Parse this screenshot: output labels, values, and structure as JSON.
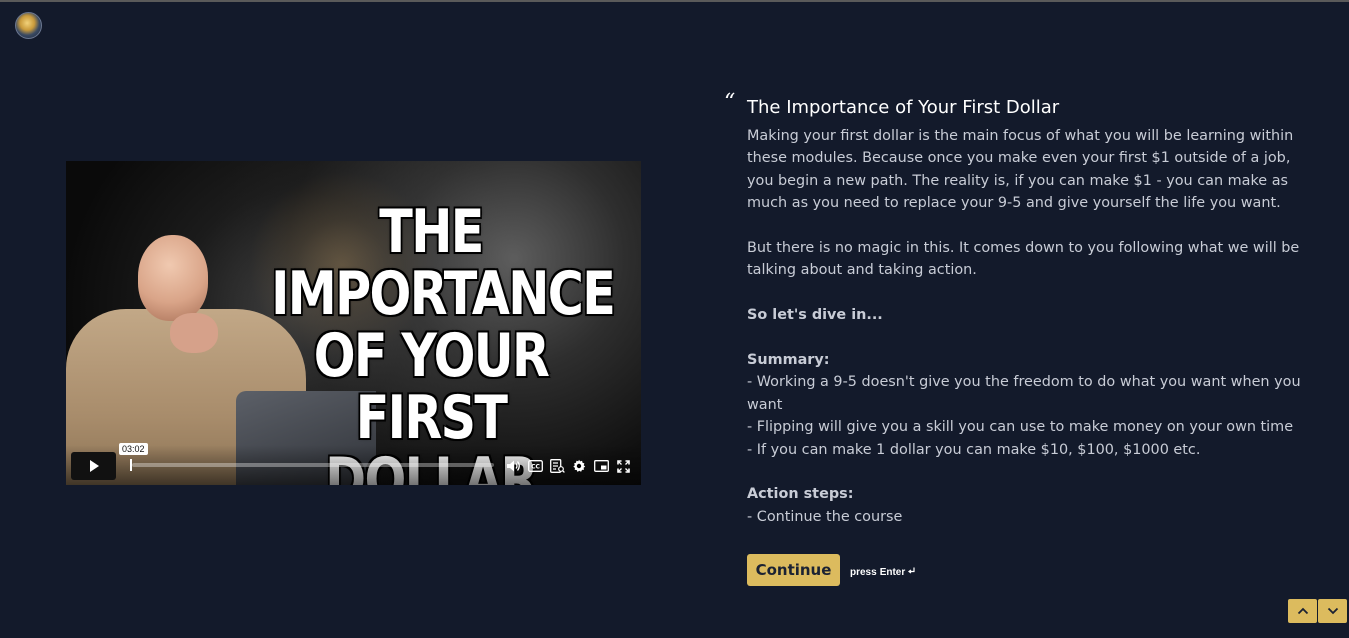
{
  "app": {
    "logo_icon": "brand-logo-icon"
  },
  "video": {
    "thumbnail_title": "THE\nIMPORTANCE\nOF YOUR FIRST\nDOLLAR",
    "current_time": "03:02",
    "progress_fraction": 0.0,
    "controls": {
      "play_icon": "play-icon",
      "volume_icon": "volume-icon",
      "captions_icon": "captions-icon",
      "transcript_icon": "transcript-icon",
      "settings_icon": "gear-icon",
      "pip_icon": "picture-in-picture-icon",
      "fullscreen_icon": "fullscreen-icon"
    }
  },
  "lesson": {
    "title": "The Importance of Your First Dollar",
    "intro": "Making your first dollar is the main focus of what you will be learning within these modules. Because once you make even your first $1 outside of a job, you begin a new path. The reality is, if you can make $1 - you can make as much as you need to replace your 9-5 and give yourself the life you want.",
    "paragraph2": "But there is no magic in this. It comes down to you following what we will be talking about and taking action.",
    "dive_in": "So let's dive in...",
    "summary_heading": "Summary:",
    "summary_items": [
      "- Working a 9-5 doesn't give you the freedom to do what you want when you want",
      "- Flipping will give you a skill you can use to make money on your own time",
      "- If you can make 1 dollar you can make $10, $100, $1000 etc."
    ],
    "action_heading": "Action steps:",
    "action_items": [
      "- Continue the course"
    ]
  },
  "footer": {
    "continue_label": "Continue",
    "press_hint_prefix": "press",
    "press_hint_key": "Enter",
    "enter_icon": "enter-key-icon"
  },
  "colors": {
    "background": "#131a2b",
    "accent": "#dcbb5e"
  }
}
